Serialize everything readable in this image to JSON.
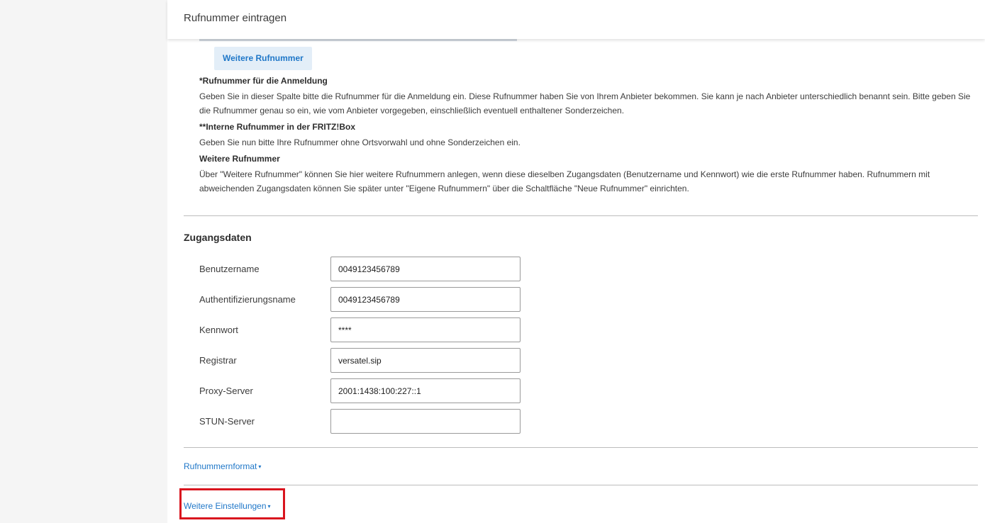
{
  "header": {
    "title": "Rufnummer eintragen"
  },
  "buttons": {
    "weitere_rufnummer": "Weitere Rufnummer"
  },
  "help": [
    {
      "heading": "*Rufnummer für die Anmeldung",
      "text": "Geben Sie in dieser Spalte bitte die Rufnummer für die Anmeldung ein. Diese Rufnummer haben Sie von Ihrem Anbieter bekommen. Sie kann je nach Anbieter unterschiedlich benannt sein. Bitte geben Sie die Rufnummer genau so ein, wie vom Anbieter vorgegeben, einschließlich eventuell enthaltener Sonderzeichen."
    },
    {
      "heading": "**Interne Rufnummer in der FRITZ!Box",
      "text": "Geben Sie nun bitte Ihre Rufnummer ohne Ortsvorwahl und ohne Sonderzeichen ein."
    },
    {
      "heading": "Weitere Rufnummer",
      "text": "Über \"Weitere Rufnummer\" können Sie hier weitere Rufnummern anlegen, wenn diese dieselben Zugangsdaten (Benutzername und Kennwort) wie die erste Rufnummer haben. Rufnummern mit abweichenden Zugangsdaten können Sie später unter \"Eigene Rufnummern\" über die Schaltfläche \"Neue Rufnummer\" einrichten."
    }
  ],
  "zugangsdaten": {
    "title": "Zugangsdaten",
    "fields": [
      {
        "label": "Benutzername",
        "value": "0049123456789"
      },
      {
        "label": "Authentifizierungsname",
        "value": "0049123456789"
      },
      {
        "label": "Kennwort",
        "value": "****"
      },
      {
        "label": "Registrar",
        "value": "versatel.sip"
      },
      {
        "label": "Proxy-Server",
        "value": "2001:1438:100:227::1"
      },
      {
        "label": "STUN-Server",
        "value": ""
      }
    ]
  },
  "links": {
    "rufnummernformat": "Rufnummernformat",
    "weitere_einstellungen": "Weitere Einstellungen"
  },
  "colors": {
    "link": "#1f77c8",
    "highlight": "#d9141e"
  }
}
